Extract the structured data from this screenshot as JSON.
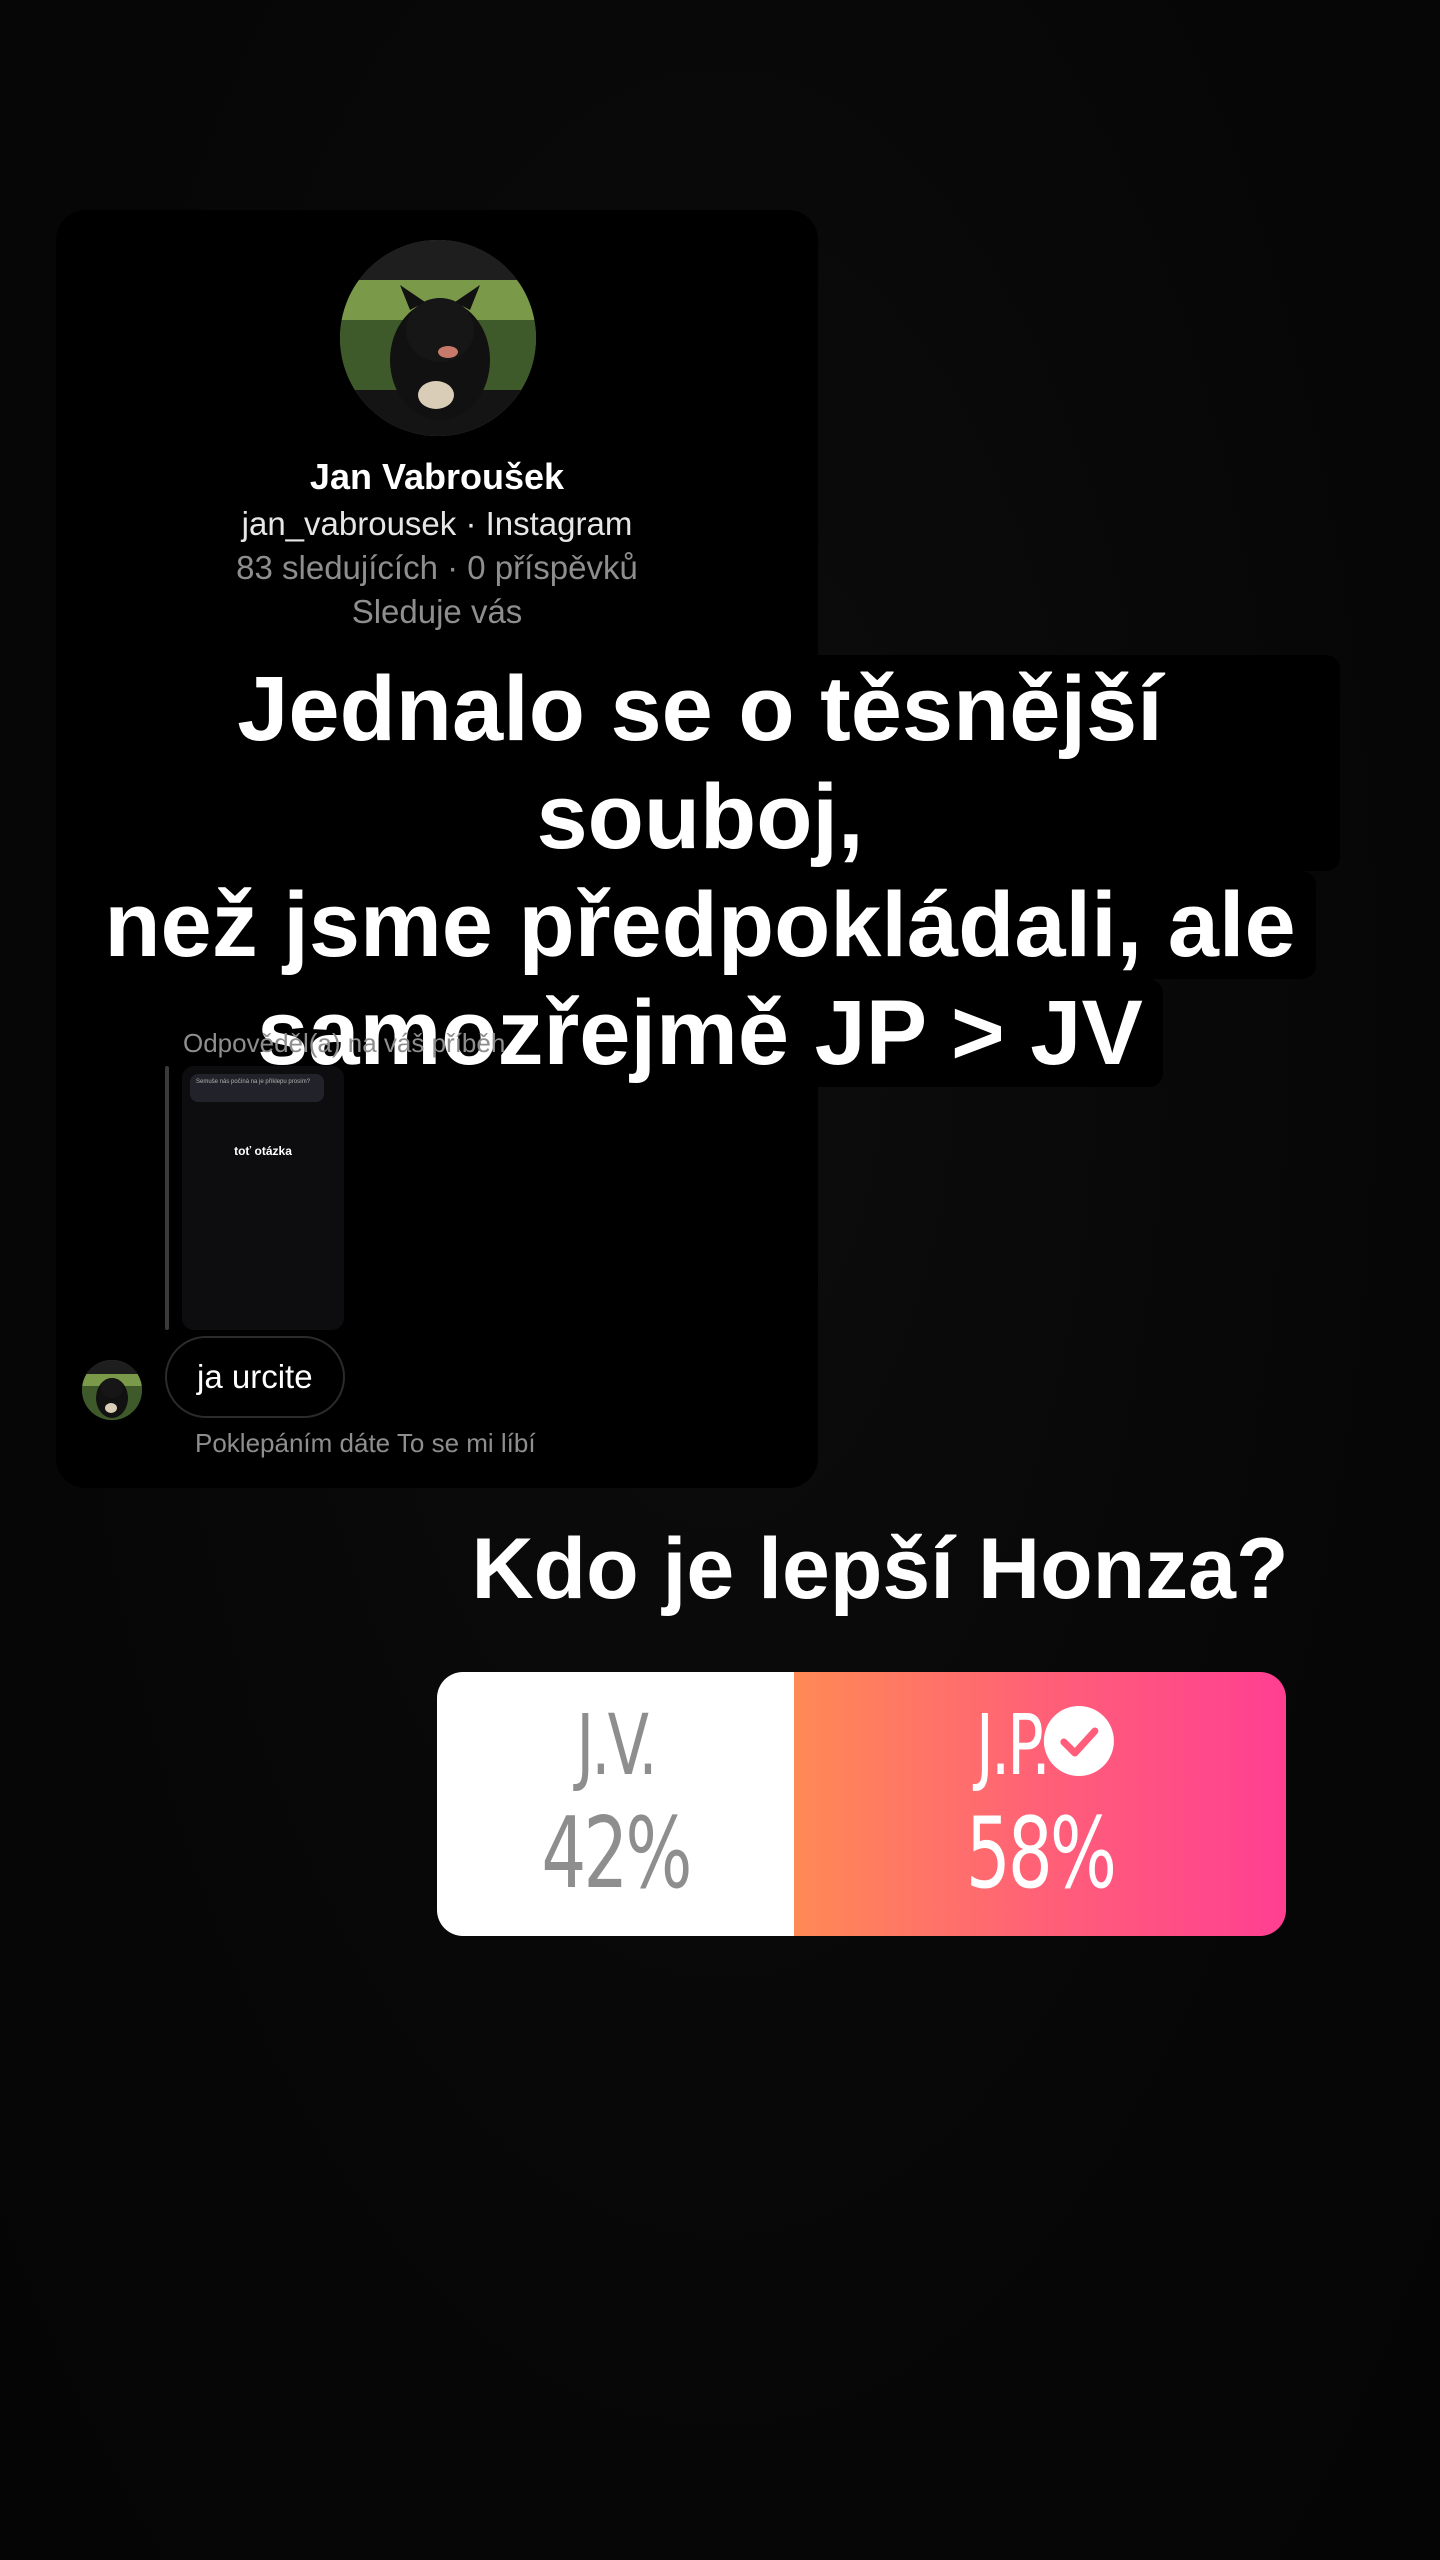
{
  "profile": {
    "name": "Jan Vabroušek",
    "handle": "jan_vabrousek · Instagram",
    "stats": "83 sledujících · 0 příspěvků",
    "follows": "Sleduje vás"
  },
  "caption": {
    "line1": "Jednalo se o těsnější souboj,",
    "line2": "než jsme předpokládali, ale",
    "line3": "samozřejmě JP > JV"
  },
  "reply": {
    "label": "Odpověděl(a) na váš příběh",
    "thumb_header": "Semuše nás počíná na je příklepu prosím?",
    "thumb_text": "toť otázka",
    "message": "ja urcite",
    "hint": "Poklepáním dáte To se mi líbí"
  },
  "poll": {
    "question": "Kdo je lepší Honza?",
    "option_a": {
      "label": "J.V.",
      "percent": "42%"
    },
    "option_b": {
      "label": "J.P.",
      "percent": "58%",
      "selected": true
    },
    "colors": {
      "gradient_start": "#ff8a55",
      "gradient_end": "#ff3f92",
      "unselected_text": "#8e8e8e"
    }
  }
}
